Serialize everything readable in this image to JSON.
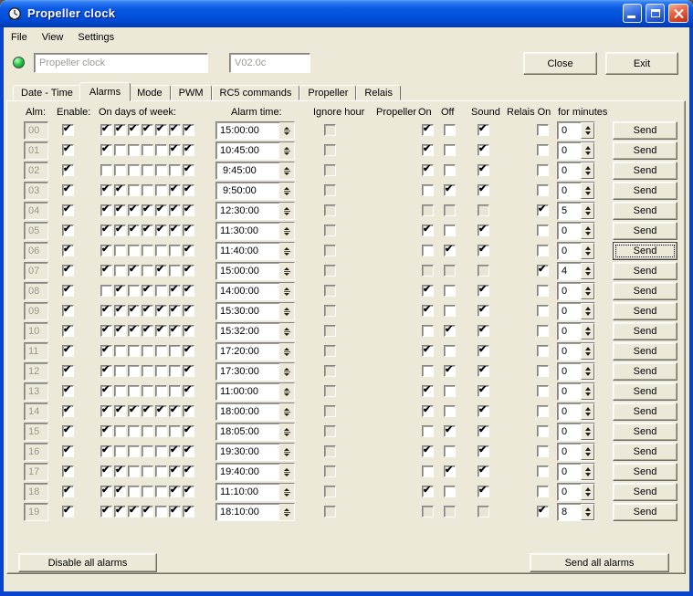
{
  "window": {
    "title": "Propeller clock",
    "buttons": [
      "minimize",
      "maximize",
      "close"
    ]
  },
  "menu": {
    "items": [
      "File",
      "View",
      "Settings"
    ]
  },
  "toolbar": {
    "device_name": "Propeller clock",
    "version": "V02.0c",
    "close_label": "Close",
    "exit_label": "Exit",
    "led_color": "#22BB44"
  },
  "tabs": {
    "items": [
      "Date - Time",
      "Alarms",
      "Mode",
      "PWM",
      "RC5 commands",
      "Propeller",
      "Relais"
    ],
    "active": "Alarms"
  },
  "alarms": {
    "headers": {
      "alm": "Alm:",
      "enable": "Enable:",
      "days": "On days of week:",
      "time": "Alarm time:",
      "ignore": "Ignore hour",
      "propeller": "Propeller",
      "on": "On",
      "off": "Off",
      "sound": "Sound",
      "relais": "Relais On",
      "minutes": "for minutes"
    },
    "send_label": "Send",
    "rows": [
      {
        "id": "00",
        "enable": true,
        "days": [
          1,
          1,
          1,
          1,
          1,
          1,
          1
        ],
        "time": "15:00:00",
        "ignore": false,
        "on": true,
        "off": false,
        "sound": true,
        "relais": false,
        "minutes": "0",
        "aux_disabled": false,
        "send_focused": false
      },
      {
        "id": "01",
        "enable": true,
        "days": [
          1,
          0,
          0,
          0,
          0,
          1,
          1
        ],
        "time": "10:45:00",
        "ignore": false,
        "on": true,
        "off": false,
        "sound": true,
        "relais": false,
        "minutes": "0",
        "aux_disabled": false,
        "send_focused": false
      },
      {
        "id": "02",
        "enable": true,
        "days": [
          0,
          0,
          0,
          0,
          0,
          0,
          1
        ],
        "time": " 9:45:00",
        "ignore": false,
        "on": true,
        "off": false,
        "sound": true,
        "relais": false,
        "minutes": "0",
        "aux_disabled": false,
        "send_focused": false
      },
      {
        "id": "03",
        "enable": true,
        "days": [
          1,
          1,
          0,
          0,
          0,
          1,
          1
        ],
        "time": " 9:50:00",
        "ignore": false,
        "on": false,
        "off": true,
        "sound": true,
        "relais": false,
        "minutes": "0",
        "aux_disabled": false,
        "send_focused": false
      },
      {
        "id": "04",
        "enable": true,
        "days": [
          1,
          1,
          1,
          1,
          1,
          1,
          1
        ],
        "time": "12:30:00",
        "ignore": false,
        "on": false,
        "off": false,
        "sound": false,
        "relais": true,
        "minutes": "5",
        "aux_disabled": true,
        "send_focused": false
      },
      {
        "id": "05",
        "enable": true,
        "days": [
          1,
          1,
          1,
          1,
          1,
          1,
          1
        ],
        "time": "11:30:00",
        "ignore": false,
        "on": true,
        "off": false,
        "sound": true,
        "relais": false,
        "minutes": "0",
        "aux_disabled": false,
        "send_focused": false
      },
      {
        "id": "06",
        "enable": true,
        "days": [
          1,
          0,
          0,
          0,
          0,
          0,
          1
        ],
        "time": "11:40:00",
        "ignore": false,
        "on": false,
        "off": true,
        "sound": true,
        "relais": false,
        "minutes": "0",
        "aux_disabled": false,
        "send_focused": true
      },
      {
        "id": "07",
        "enable": true,
        "days": [
          1,
          0,
          1,
          0,
          1,
          0,
          1
        ],
        "time": "15:00:00",
        "ignore": false,
        "on": false,
        "off": false,
        "sound": false,
        "relais": true,
        "minutes": "4",
        "aux_disabled": true,
        "send_focused": false
      },
      {
        "id": "08",
        "enable": true,
        "days": [
          0,
          1,
          0,
          1,
          0,
          1,
          1
        ],
        "time": "14:00:00",
        "ignore": false,
        "on": true,
        "off": false,
        "sound": true,
        "relais": false,
        "minutes": "0",
        "aux_disabled": false,
        "send_focused": false
      },
      {
        "id": "09",
        "enable": true,
        "days": [
          1,
          1,
          1,
          1,
          1,
          1,
          1
        ],
        "time": "15:30:00",
        "ignore": false,
        "on": true,
        "off": false,
        "sound": true,
        "relais": false,
        "minutes": "0",
        "aux_disabled": false,
        "send_focused": false
      },
      {
        "id": "10",
        "enable": true,
        "days": [
          1,
          1,
          1,
          1,
          1,
          1,
          1
        ],
        "time": "15:32:00",
        "ignore": false,
        "on": false,
        "off": true,
        "sound": true,
        "relais": false,
        "minutes": "0",
        "aux_disabled": false,
        "send_focused": false
      },
      {
        "id": "11",
        "enable": true,
        "days": [
          1,
          0,
          0,
          0,
          0,
          0,
          1
        ],
        "time": "17:20:00",
        "ignore": false,
        "on": true,
        "off": false,
        "sound": true,
        "relais": false,
        "minutes": "0",
        "aux_disabled": false,
        "send_focused": false
      },
      {
        "id": "12",
        "enable": true,
        "days": [
          1,
          0,
          0,
          0,
          0,
          0,
          1
        ],
        "time": "17:30:00",
        "ignore": false,
        "on": false,
        "off": true,
        "sound": true,
        "relais": false,
        "minutes": "0",
        "aux_disabled": false,
        "send_focused": false
      },
      {
        "id": "13",
        "enable": true,
        "days": [
          1,
          0,
          0,
          0,
          0,
          0,
          1
        ],
        "time": "11:00:00",
        "ignore": false,
        "on": true,
        "off": false,
        "sound": true,
        "relais": false,
        "minutes": "0",
        "aux_disabled": false,
        "send_focused": false
      },
      {
        "id": "14",
        "enable": true,
        "days": [
          1,
          1,
          1,
          1,
          1,
          1,
          1
        ],
        "time": "18:00:00",
        "ignore": false,
        "on": true,
        "off": false,
        "sound": true,
        "relais": false,
        "minutes": "0",
        "aux_disabled": false,
        "send_focused": false
      },
      {
        "id": "15",
        "enable": true,
        "days": [
          1,
          0,
          0,
          0,
          0,
          0,
          1
        ],
        "time": "18:05:00",
        "ignore": false,
        "on": false,
        "off": true,
        "sound": true,
        "relais": false,
        "minutes": "0",
        "aux_disabled": false,
        "send_focused": false
      },
      {
        "id": "16",
        "enable": true,
        "days": [
          1,
          0,
          0,
          0,
          0,
          1,
          1
        ],
        "time": "19:30:00",
        "ignore": false,
        "on": true,
        "off": false,
        "sound": true,
        "relais": false,
        "minutes": "0",
        "aux_disabled": false,
        "send_focused": false
      },
      {
        "id": "17",
        "enable": true,
        "days": [
          1,
          1,
          0,
          0,
          0,
          1,
          1
        ],
        "time": "19:40:00",
        "ignore": false,
        "on": false,
        "off": true,
        "sound": true,
        "relais": false,
        "minutes": "0",
        "aux_disabled": false,
        "send_focused": false
      },
      {
        "id": "18",
        "enable": true,
        "days": [
          1,
          1,
          0,
          0,
          0,
          1,
          1
        ],
        "time": "11:10:00",
        "ignore": false,
        "on": true,
        "off": false,
        "sound": true,
        "relais": false,
        "minutes": "0",
        "aux_disabled": false,
        "send_focused": false
      },
      {
        "id": "19",
        "enable": true,
        "days": [
          1,
          1,
          1,
          1,
          0,
          1,
          1
        ],
        "time": "18:10:00",
        "ignore": false,
        "on": false,
        "off": false,
        "sound": false,
        "relais": true,
        "minutes": "8",
        "aux_disabled": true,
        "send_focused": false
      }
    ]
  },
  "footer": {
    "disable_all": "Disable all alarms",
    "send_all": "Send all alarms"
  },
  "icons": {
    "check": "✔"
  }
}
